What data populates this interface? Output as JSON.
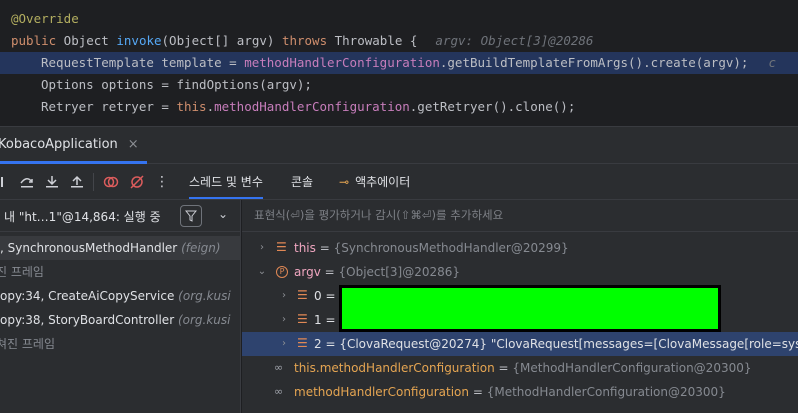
{
  "editor": {
    "lines": [
      {
        "annotation": "@Override"
      },
      {
        "kw1": "public",
        "type1": " Object ",
        "method": "invoke",
        "params": "(Object[] argv) ",
        "kw2": "throws",
        "rest": " Throwable {",
        "hint": "argv: Object[3]@20286"
      },
      {
        "pre": "RequestTemplate template = ",
        "field": "methodHandlerConfiguration",
        "post": ".getBuildTemplateFromArgs().create(argv);",
        "trail": "c"
      },
      {
        "text": "Options options = findOptions(argv);"
      },
      {
        "pre": "Retryer retryer = ",
        "kw": "this",
        "dot": ".",
        "field": "methodHandlerConfiguration",
        "post": ".getRetryer().clone();"
      }
    ]
  },
  "tab": {
    "label": "KobacoApplication",
    "close": "×"
  },
  "toolbar": {
    "tabs": [
      "스레드 및 변수",
      "콘솔",
      "액추에이터"
    ]
  },
  "thread": {
    "label": "내 \"ht…1\"@14,864: 실행 중"
  },
  "frames": [
    {
      "name": ", SynchronousMethodHandler",
      "pkg": "(feign)",
      "selected": true
    },
    {
      "name": "진 프레임",
      "dim": true
    },
    {
      "name": "opy:34, CreateAiCopyService",
      "pkg": "(org.kusi"
    },
    {
      "name": "opy:38, StoryBoardController",
      "pkg": "(org.kusi"
    },
    {
      "name": "쳐진 프레임",
      "dim": true
    }
  ],
  "eval_placeholder": "표현식(⏎)을 평가하거나 감시(⇧⌘⏎)를 추가하세요",
  "variables": [
    {
      "name": "this",
      "value": "{SynchronousMethodHandler@20299}"
    },
    {
      "name": "argv",
      "value": "{Object[3]@20286}"
    },
    {
      "name": "0",
      "value": ""
    },
    {
      "name": "1",
      "value": ""
    },
    {
      "name": "2",
      "value": "{ClovaRequest@20274} \"ClovaRequest[messages=[ClovaMessage[role=sys"
    },
    {
      "name": "this.methodHandlerConfiguration",
      "value": "{MethodHandlerConfiguration@20300}"
    },
    {
      "name": "methodHandlerConfiguration",
      "value": "{MethodHandlerConfiguration@20300}"
    }
  ],
  "colors": {
    "accent": "#3574f0",
    "redaction": "#00ff00"
  }
}
